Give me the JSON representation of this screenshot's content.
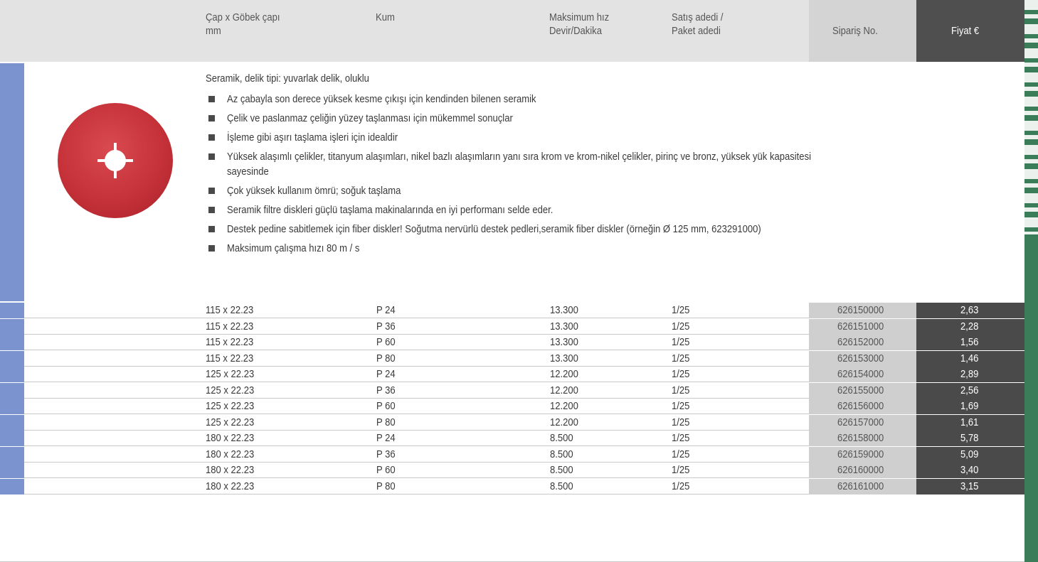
{
  "header": {
    "cap": "Çap x Göbek çapı\nmm",
    "kum": "Kum",
    "hiz": "Maksimum hız\nDevir/Dakika",
    "satis": "Satış adedi /\nPaket adedi",
    "siparis": "Sipariş  No.",
    "fiyat": "Fiyat €"
  },
  "product": {
    "image_icon": "fiber-disc-image",
    "intro": "Seramik, delik tipi: yuvarlak delik, oluklu",
    "bullets": [
      "Az çabayla son derece yüksek kesme çıkışı için kendinden bilenen seramik",
      "Çelik ve paslanmaz çeliğin yüzey taşlanması için mükemmel sonuçlar",
      "İşleme gibi aşırı taşlama işleri için idealdir",
      "Yüksek alaşımlı çelikler, titanyum alaşımları, nikel bazlı alaşımların yanı sıra krom ve krom-nikel çelikler, pirinç ve bronz, yüksek yük kapasitesi\nsayesinde",
      "Çok yüksek kullanım ömrü; soğuk taşlama",
      "Seramik filtre diskleri güçlü taşlama makinalarında en iyi performanı selde eder.",
      "Destek pedine sabitlemek için fiber diskler! Soğutma nervürlü destek pedleri,seramik fiber diskler (örneğin Ø 125 mm, 623291000)",
      "Maksimum çalışma hızı 80 m / s"
    ]
  },
  "rows": [
    {
      "cap": "115 x 22.23",
      "kum": "P 24",
      "hiz": "13.300",
      "satis": "1/25",
      "siparis": "626150000",
      "fiyat": "2,63"
    },
    {
      "cap": "115 x 22.23",
      "kum": "P 36",
      "hiz": "13.300",
      "satis": "1/25",
      "siparis": "626151000",
      "fiyat": "2,28"
    },
    {
      "cap": "115 x 22.23",
      "kum": "P 60",
      "hiz": "13.300",
      "satis": "1/25",
      "siparis": "626152000",
      "fiyat": "1,56"
    },
    {
      "cap": "115 x 22.23",
      "kum": "P 80",
      "hiz": "13.300",
      "satis": "1/25",
      "siparis": "626153000",
      "fiyat": "1,46"
    },
    {
      "cap": "125 x 22.23",
      "kum": "P 24",
      "hiz": "12.200",
      "satis": "1/25",
      "siparis": "626154000",
      "fiyat": "2,89"
    },
    {
      "cap": "125 x 22.23",
      "kum": "P 36",
      "hiz": "12.200",
      "satis": "1/25",
      "siparis": "626155000",
      "fiyat": "2,56"
    },
    {
      "cap": "125 x 22.23",
      "kum": "P 60",
      "hiz": "12.200",
      "satis": "1/25",
      "siparis": "626156000",
      "fiyat": "1,69"
    },
    {
      "cap": "125 x 22.23",
      "kum": "P 80",
      "hiz": "12.200",
      "satis": "1/25",
      "siparis": "626157000",
      "fiyat": "1,61"
    },
    {
      "cap": "180 x 22.23",
      "kum": "P 24",
      "hiz": "8.500",
      "satis": "1/25",
      "siparis": "626158000",
      "fiyat": "5,78"
    },
    {
      "cap": "180 x 22.23",
      "kum": "P 36",
      "hiz": "8.500",
      "satis": "1/25",
      "siparis": "626159000",
      "fiyat": "5,09"
    },
    {
      "cap": "180 x 22.23",
      "kum": "P 60",
      "hiz": "8.500",
      "satis": "1/25",
      "siparis": "626160000",
      "fiyat": "3,40"
    },
    {
      "cap": "180 x 22.23",
      "kum": "P 80",
      "hiz": "8.500",
      "satis": "1/25",
      "siparis": "626161000",
      "fiyat": "3,15"
    }
  ],
  "colors": {
    "accent_blue": "#7b93cf",
    "price_bg": "#4a4a4a",
    "order_bg": "#cfcfcf",
    "side_tab_green": "#3b7d58"
  }
}
